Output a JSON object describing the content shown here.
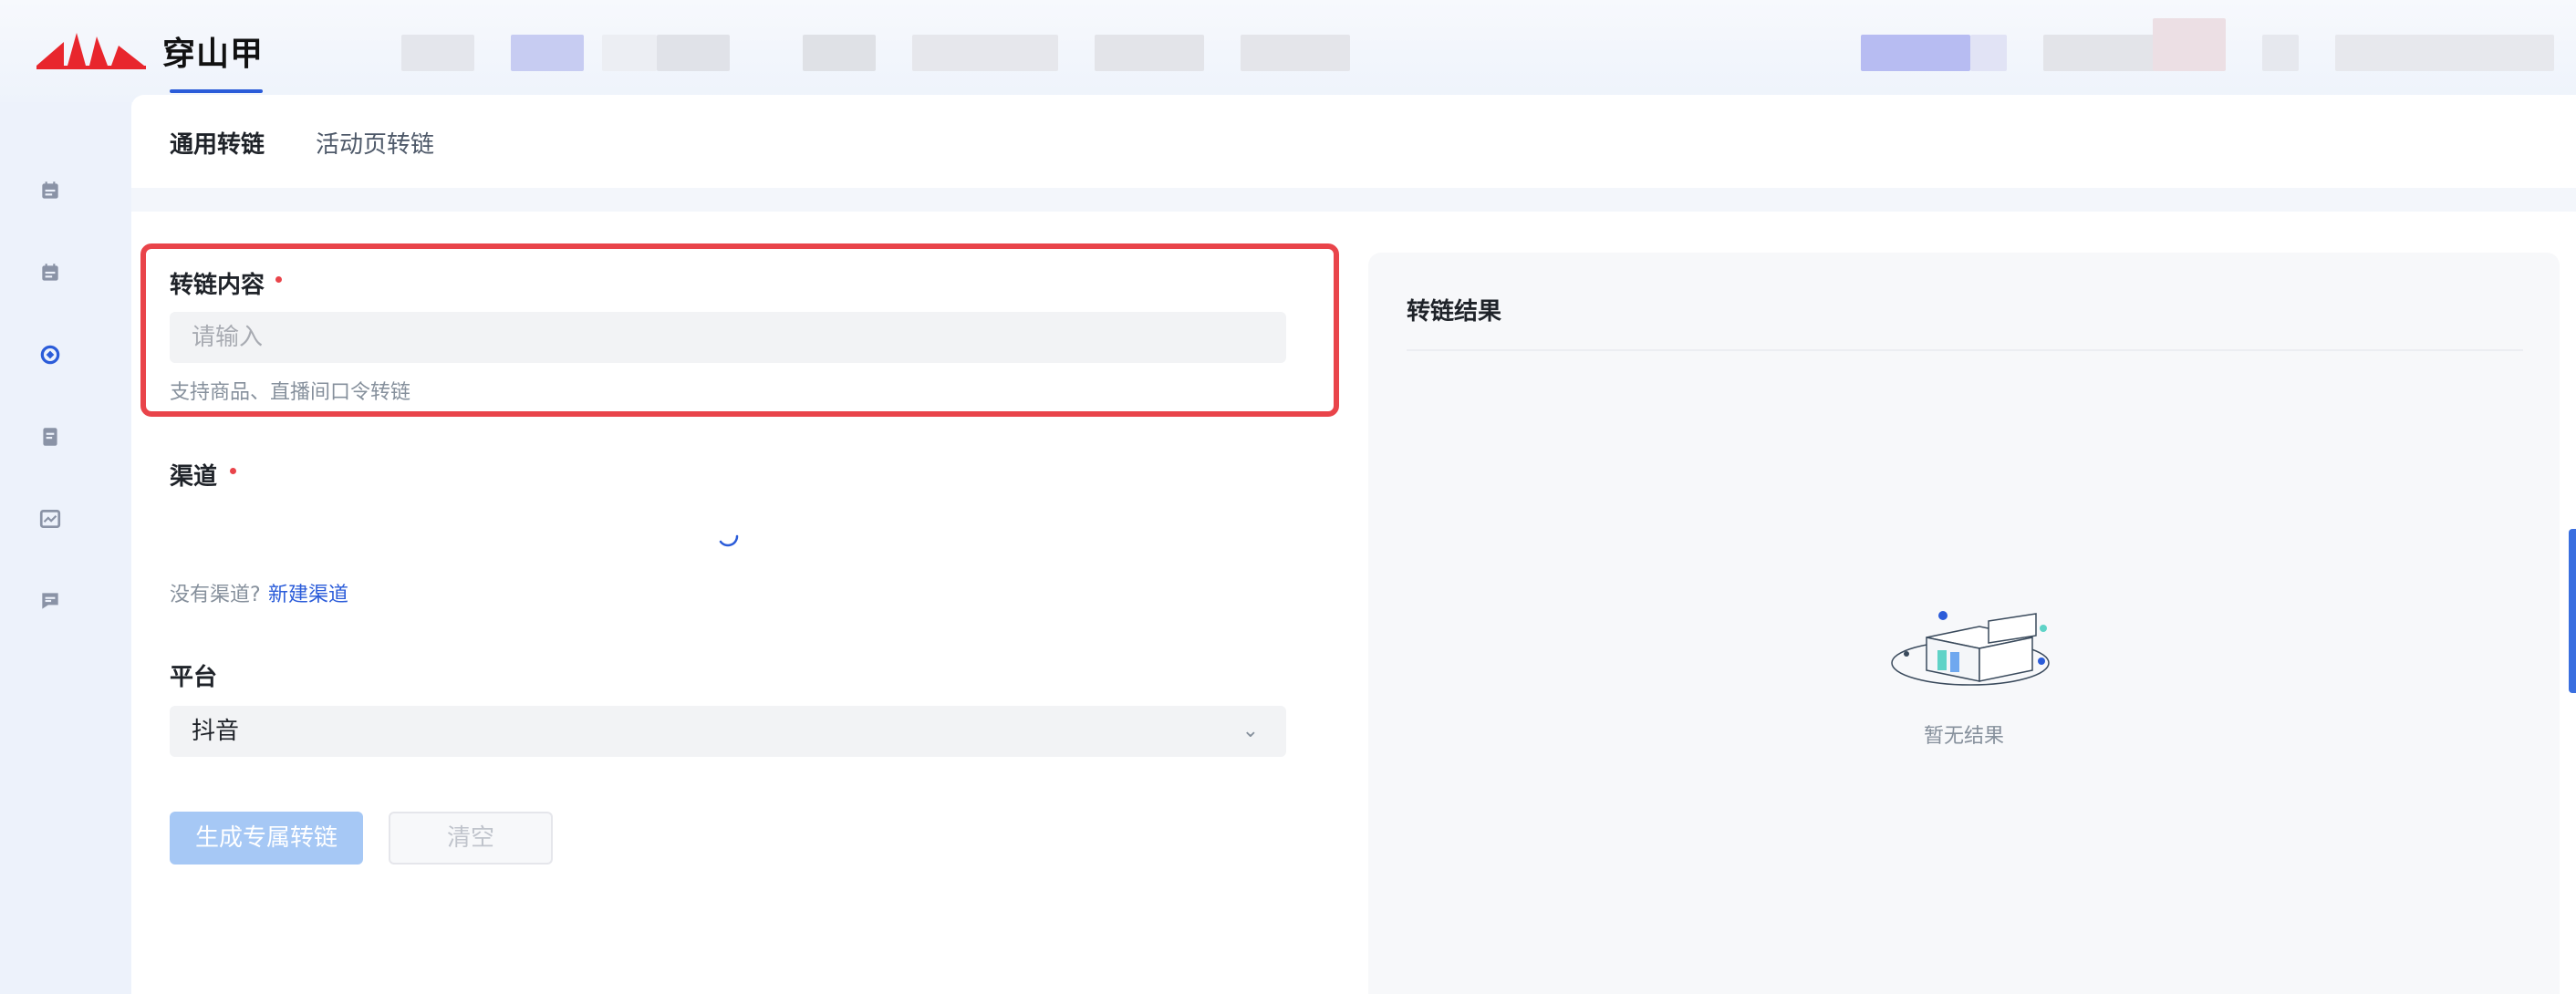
{
  "app": {
    "name": "穿山甲",
    "brand_color": "#e8262d"
  },
  "sidebar": {
    "icons": [
      "calendar-icon",
      "calendar-icon",
      "link-convert-icon",
      "document-icon",
      "chart-icon",
      "message-icon"
    ],
    "active_index": 2,
    "accent": "#2b5cd9"
  },
  "tabs": [
    {
      "label": "通用转链",
      "active": true
    },
    {
      "label": "活动页转链",
      "active": false
    }
  ],
  "form": {
    "content": {
      "label": "转链内容",
      "required": true,
      "placeholder": "请输入",
      "hint": "支持商品、直播间口令转链"
    },
    "channel": {
      "label": "渠道",
      "required": true,
      "loading": true,
      "empty_prompt": "没有渠道?",
      "create_link": "新建渠道"
    },
    "platform": {
      "label": "平台",
      "selected": "抖音"
    },
    "buttons": {
      "generate": "生成专属转链",
      "clear": "清空"
    }
  },
  "result": {
    "title": "转链结果",
    "empty_text": "暂无结果"
  },
  "colors": {
    "primary": "#2b5cd9",
    "primary_disabled": "#a6c8f5",
    "required": "#e9444a",
    "highlight_border": "#e9444a"
  }
}
